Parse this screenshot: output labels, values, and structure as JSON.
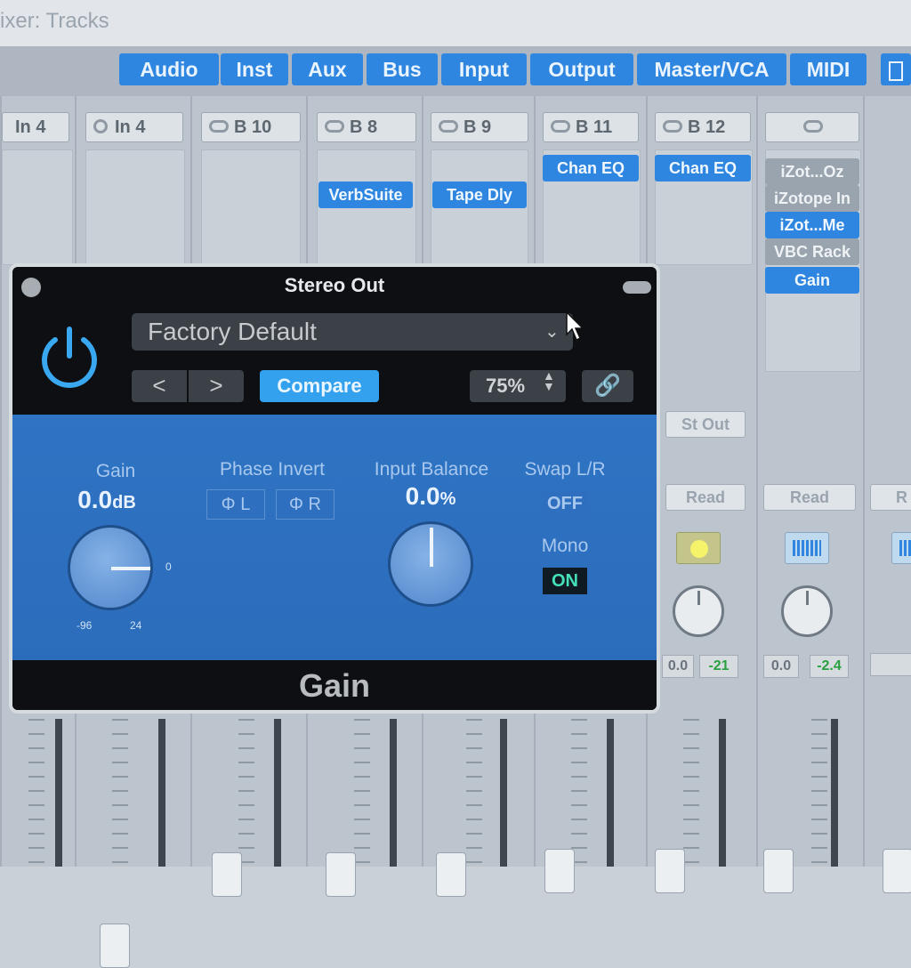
{
  "window": {
    "title": "ixer: Tracks"
  },
  "filters": {
    "buttons": [
      "Audio",
      "Inst",
      "Aux",
      "Bus",
      "Input",
      "Output",
      "Master/VCA",
      "MIDI"
    ]
  },
  "channels": [
    {
      "io": "In 4"
    },
    {
      "io": "In 4"
    },
    {
      "io": "B 10"
    },
    {
      "io": "B 8",
      "inserts": [
        "VerbSuite"
      ]
    },
    {
      "io": "B 9",
      "inserts": [
        "Tape Dly"
      ]
    },
    {
      "io": "B 11",
      "inserts": [
        "Chan EQ"
      ]
    },
    {
      "io": "B 12",
      "inserts": [
        "Chan EQ"
      ],
      "output": "St Out",
      "automation": "Read",
      "volume": "0.0",
      "peak": "-21"
    },
    {
      "io": "",
      "inserts": [
        "iZot...Oz",
        "iZotope In",
        "iZot...Me",
        "VBC Rack",
        "Gain"
      ],
      "automation": "Read",
      "volume": "0.0",
      "peak": "-2.4"
    },
    {
      "automation": "R"
    }
  ],
  "plugin": {
    "window_title": "Stereo Out",
    "preset": "Factory Default",
    "prev": "<",
    "next": ">",
    "compare_label": "Compare",
    "zoom": "75%",
    "gain": {
      "label": "Gain",
      "value": "0.0",
      "unit": "dB",
      "min": "-96",
      "max": "24",
      "zero": "0"
    },
    "phase_invert": {
      "label": "Phase Invert",
      "left": "L",
      "right": "R",
      "glyph": "Φ"
    },
    "input_balance": {
      "label": "Input Balance",
      "value": "0.0",
      "unit": "%"
    },
    "swap_lr": {
      "label": "Swap L/R",
      "state": "OFF"
    },
    "mono": {
      "label": "Mono",
      "state": "ON"
    },
    "plugin_name": "Gain"
  },
  "colors": {
    "accent": "#2e86e0",
    "panel": "#2f73c4",
    "on": "#45e0b6"
  }
}
